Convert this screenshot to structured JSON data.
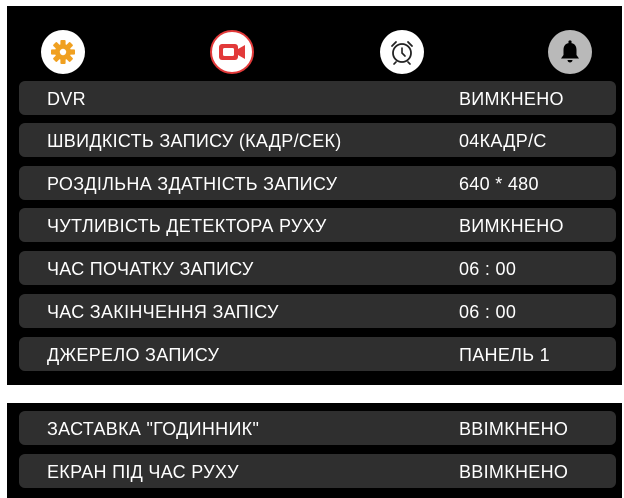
{
  "colors": {
    "panel_bg": "#000000",
    "row_bg": "#2f2f2f",
    "accent_red": "#e23a3a",
    "gear_orange": "#f0a020",
    "text": "#ffffff"
  },
  "toolbar": {
    "icons": [
      {
        "name": "settings-gear-icon",
        "state": "inactive"
      },
      {
        "name": "video-record-icon",
        "state": "active"
      },
      {
        "name": "alarm-clock-icon",
        "state": "inactive"
      },
      {
        "name": "bell-icon",
        "state": "inactive"
      }
    ]
  },
  "settings": [
    {
      "label": "DVR",
      "value": "ВИМКНЕНО"
    },
    {
      "label": "ШВИДКІСТЬ ЗАПИСУ (КАДР/СЕК)",
      "value": "04КАДР/С"
    },
    {
      "label": "РОЗДІЛЬНА ЗДАТНІСТЬ ЗАПИСУ",
      "value": "640 * 480"
    },
    {
      "label": "ЧУТЛИВІСТЬ ДЕТЕКТОРА РУХУ",
      "value": "ВИМКНЕНО"
    },
    {
      "label": "ЧАС ПОЧАТКУ ЗАПИСУ",
      "value": "06 : 00"
    },
    {
      "label": "ЧАС ЗАКІНЧЕННЯ ЗАПІСУ",
      "value": "06 : 00"
    },
    {
      "label": "ДЖЕРЕЛО ЗАПИСУ",
      "value": "ПАНЕЛЬ 1"
    }
  ],
  "screen_settings": [
    {
      "label": "ЗАСТАВКА \"ГОДИННИК\"",
      "value": "ВВІМКНЕНО"
    },
    {
      "label": "ЕКРАН ПІД ЧАС РУХУ",
      "value": "ВВІМКНЕНО"
    }
  ]
}
